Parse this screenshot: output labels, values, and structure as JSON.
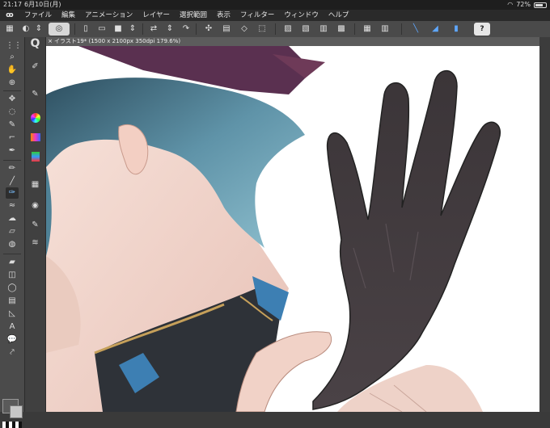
{
  "status_bar": {
    "time": "21:17",
    "date": "6月10日(月)",
    "battery_text": "72%",
    "battery_level": 0.72
  },
  "menu": {
    "items": [
      "ファイル",
      "編集",
      "アニメーション",
      "レイヤー",
      "選択範囲",
      "表示",
      "フィルター",
      "ウィンドウ",
      "ヘルプ"
    ]
  },
  "canvas": {
    "tab_title": "イラスト19* (1500 x 2100px 350dpi 179.6%)",
    "zoom": "179.6%"
  },
  "colors": {
    "main_color": "#5a5a5a",
    "sub_color": "#c7c7c7",
    "accent": "#5fa8ff"
  },
  "icons": {
    "help": "?",
    "tool_text": "A"
  }
}
